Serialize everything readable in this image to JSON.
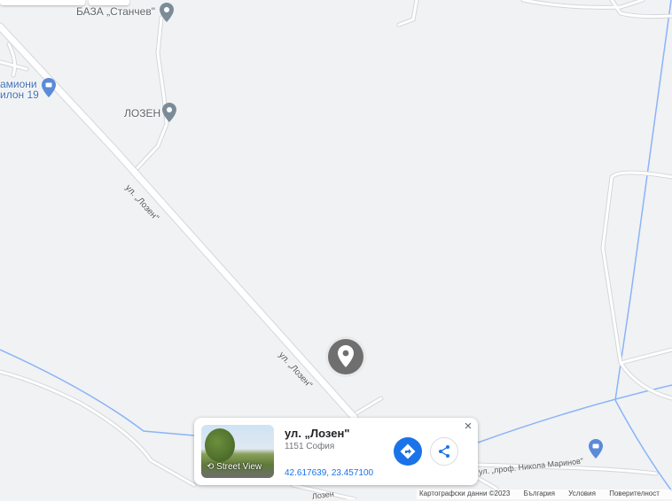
{
  "map": {
    "places": [
      {
        "name": "БАЗА „Станчев\""
      },
      {
        "name": "ЛОЗЕН"
      },
      {
        "name": "амиони"
      },
      {
        "name": "илон 19"
      }
    ],
    "streets": [
      {
        "name": "ул. „Лозен\""
      },
      {
        "name": "ул. „Лозен\""
      },
      {
        "name": "ул. „проф. Никола Маринов\""
      },
      {
        "name": "Лозен"
      }
    ]
  },
  "card": {
    "title": "ул. „Лозен\"",
    "subtitle": "1151 София",
    "coordinates": "42.617639, 23.457100",
    "street_view_label": "Street View",
    "close_label": "×"
  },
  "attribution": {
    "map_data": "Картографски данни ©2023",
    "country": "България",
    "terms": "Условия",
    "privacy": "Поверителност"
  },
  "colors": {
    "background": "#f1f2f4",
    "road": "#ffffff",
    "road_edge": "#d3d6da",
    "water": "#8ab4f8",
    "pin_gray": "#7b8c99",
    "pin_blue": "#5b8ad8",
    "accent": "#1a73e8"
  }
}
